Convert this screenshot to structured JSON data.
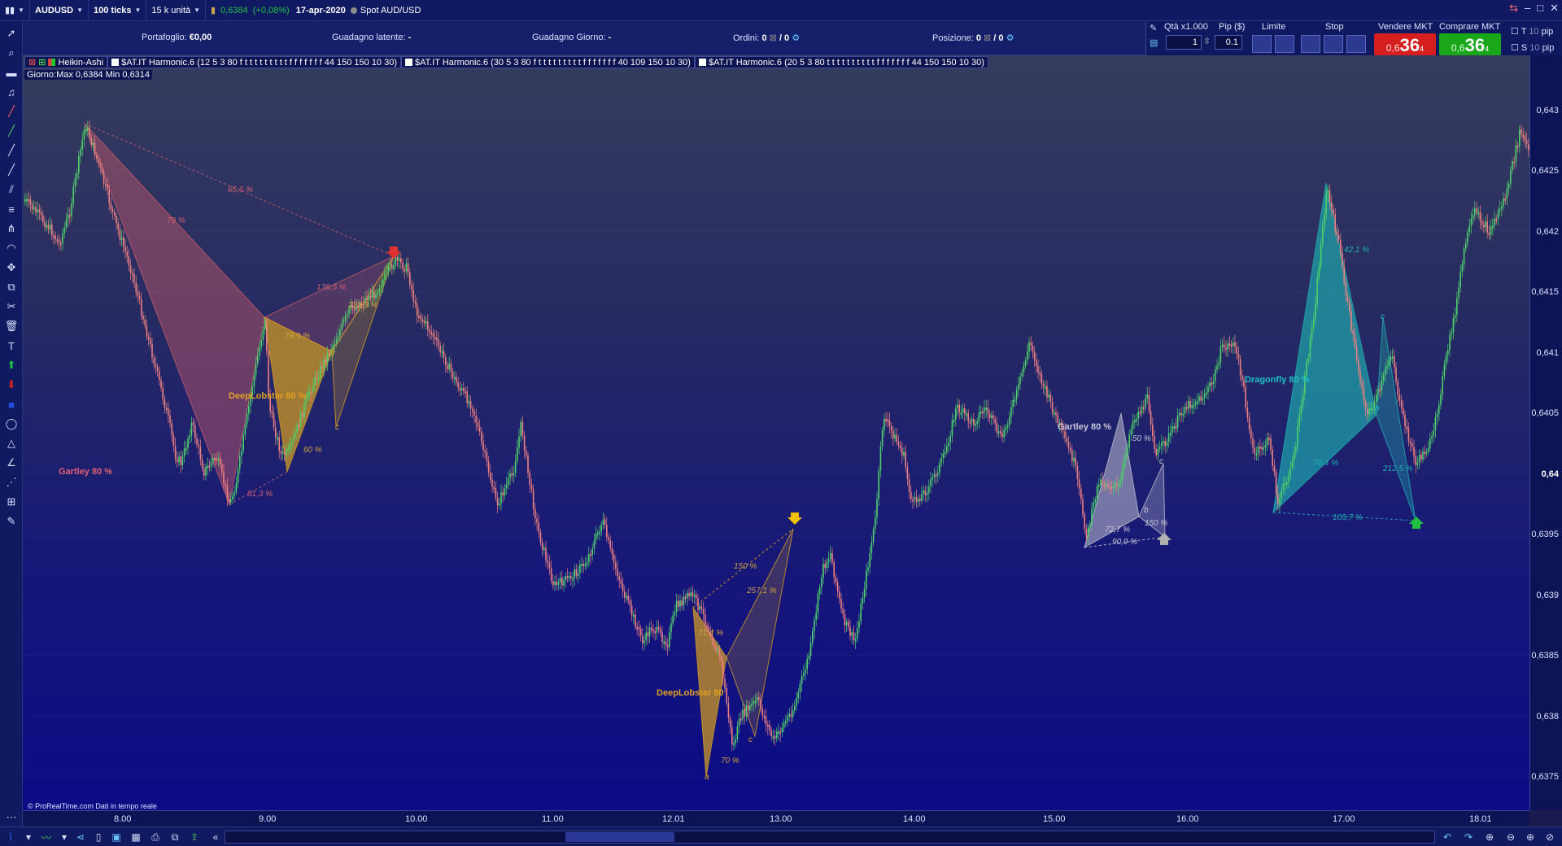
{
  "topbar": {
    "symbol": "AUDUSD",
    "ticks": "100 ticks",
    "units": "15 k unità",
    "price": "0,6384",
    "change": "(+0,08%)",
    "date": "17-apr-2020",
    "instrument": "Spot AUD/USD"
  },
  "tradepanel": {
    "portafoglio_label": "Portafoglio:",
    "portafoglio_value": "€0,00",
    "latente_label": "Guadagno latente:",
    "latente_value": "-",
    "giorno_label": "Guadagno Giorno:",
    "giorno_value": "-",
    "ordini_label": "Ordini:",
    "ordini_value": "0",
    "ordini_value2": "/ 0",
    "posizione_label": "Posizione:",
    "posizione_value": "0",
    "posizione_value2": "/ 0"
  },
  "orderbox": {
    "qty_label": "Qtà x1.000",
    "pip_label": "Pip ($)",
    "limite_label": "Limite",
    "stop_label": "Stop",
    "sell_label": "Vendere MKT",
    "buy_label": "Comprare MKT",
    "qty_value": "1",
    "pip_value": "0.1",
    "sell_small": "0,6",
    "sell_big": "36",
    "sell_sup": "4",
    "buy_small": "0,6",
    "buy_big": "36",
    "buy_sup": "4",
    "t_label": "T",
    "s_label": "S",
    "t_pip": "10",
    "s_pip": "10",
    "pip_unit": "pip"
  },
  "legend": {
    "heikin": "Heikin-Ashi",
    "h1": "$AT.IT Harmonic.6 (12 5 3 80 f t t t t t t t t t f f f f f f f 44 150 150 10 30)",
    "h2": "$AT.IT Harmonic.6 (30 5 3 80 f t t t t t t t t t f f f f f f f 40 109 150 10 30)",
    "h3": "$AT.IT Harmonic.6 (20 5 3 80 t t t t t t t t t t f f f f f f f 44 150 150 10 30)",
    "dayrange": "Giorno:Max 0,6384 Min 0,6314"
  },
  "yaxis": {
    "labels": [
      "0,643",
      "0,6425",
      "0,642",
      "0,6415",
      "0,641",
      "0,6405",
      "0,64",
      "0,6395",
      "0,639",
      "0,6385",
      "0,638",
      "0,6375"
    ],
    "current": "0,64"
  },
  "xaxis": {
    "labels": [
      "8.00",
      "9.00",
      "10.00",
      "11.00",
      "12.01",
      "13.00",
      "14.00",
      "15.00",
      "16.00",
      "17.00",
      "18.01"
    ]
  },
  "copyright": "© ProRealTime.com  Dati in tempo reale",
  "patterns": {
    "gartley1_name": "Gartley 80 %",
    "deeplobster1_name": "DeepLobster 80 %",
    "deeplobster2_name": "DeepLobster 80",
    "gartley2_name": "Gartley 80 %",
    "dragonfly_name": "Dragonfly 80 %",
    "ratios": [
      "65,6 %",
      "78 %",
      "138,5 %",
      "233,3 %",
      "78,9 %",
      "60 %",
      "81,3 %",
      "150 %",
      "257,1 %",
      "71,4 %",
      "70 %",
      "50 %",
      "72,7 %",
      "150 %",
      "90,9 %",
      "42,1 %",
      "70,4 %",
      "212,5 %",
      "103,7 %"
    ]
  },
  "colors": {
    "bull": "#4fd26a",
    "bear": "#f08080",
    "gartley1": "#c85a6a",
    "lobster": "#d9a020",
    "gartley2": "#c0c0d0",
    "dragonfly": "#1fb0b0"
  }
}
